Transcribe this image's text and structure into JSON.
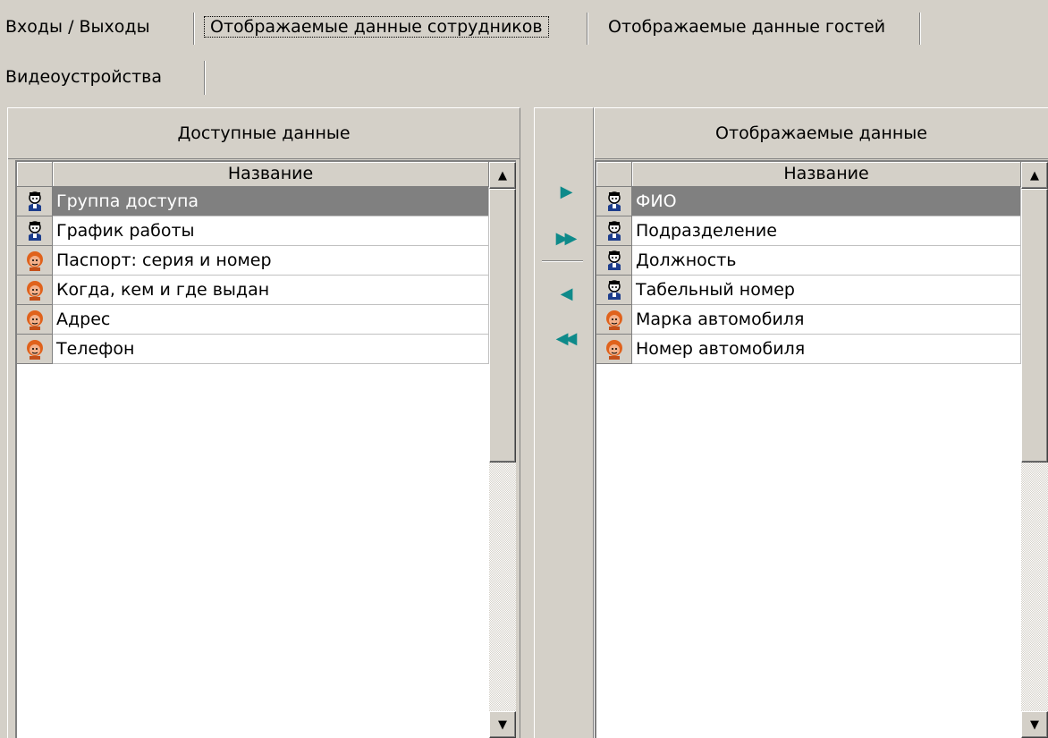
{
  "tabs": [
    {
      "label": "Входы / Выходы",
      "active": false
    },
    {
      "label": "Отображаемые данные сотрудников",
      "active": true
    },
    {
      "label": "Отображаемые данные гостей",
      "active": false
    },
    {
      "label": "Видеоустройства",
      "active": false
    }
  ],
  "left_panel": {
    "header": "Доступные данные",
    "column_name": "Название",
    "rows": [
      {
        "label": "Группа доступа",
        "icon": "employee-icon",
        "selected": true
      },
      {
        "label": "График работы",
        "icon": "employee-icon",
        "selected": false
      },
      {
        "label": "Паспорт: серия и номер",
        "icon": "guest-icon",
        "selected": false
      },
      {
        "label": "Когда, кем и где выдан",
        "icon": "guest-icon",
        "selected": false
      },
      {
        "label": "Адрес",
        "icon": "guest-icon",
        "selected": false
      },
      {
        "label": "Телефон",
        "icon": "guest-icon",
        "selected": false
      }
    ]
  },
  "right_panel": {
    "header": "Отображаемые данные",
    "column_name": "Название",
    "rows": [
      {
        "label": "ФИО",
        "icon": "employee-icon",
        "selected": true
      },
      {
        "label": "Подразделение",
        "icon": "employee-icon",
        "selected": false
      },
      {
        "label": "Должность",
        "icon": "employee-icon",
        "selected": false
      },
      {
        "label": "Табельный номер",
        "icon": "employee-icon",
        "selected": false
      },
      {
        "label": "Марка автомобиля",
        "icon": "guest-icon",
        "selected": false
      },
      {
        "label": "Номер автомобиля",
        "icon": "guest-icon",
        "selected": false
      }
    ]
  },
  "transfer_buttons": [
    {
      "icon": "move-right-icon",
      "glyph": "▶"
    },
    {
      "icon": "move-all-right-icon",
      "glyph": "▶▶"
    },
    {
      "icon": "move-left-icon",
      "glyph": "◀"
    },
    {
      "icon": "move-all-left-icon",
      "glyph": "◀◀"
    }
  ],
  "colors": {
    "window_bg": "#d4d0c8",
    "selection_bg": "#808080",
    "arrow": "#0e8a8a"
  }
}
